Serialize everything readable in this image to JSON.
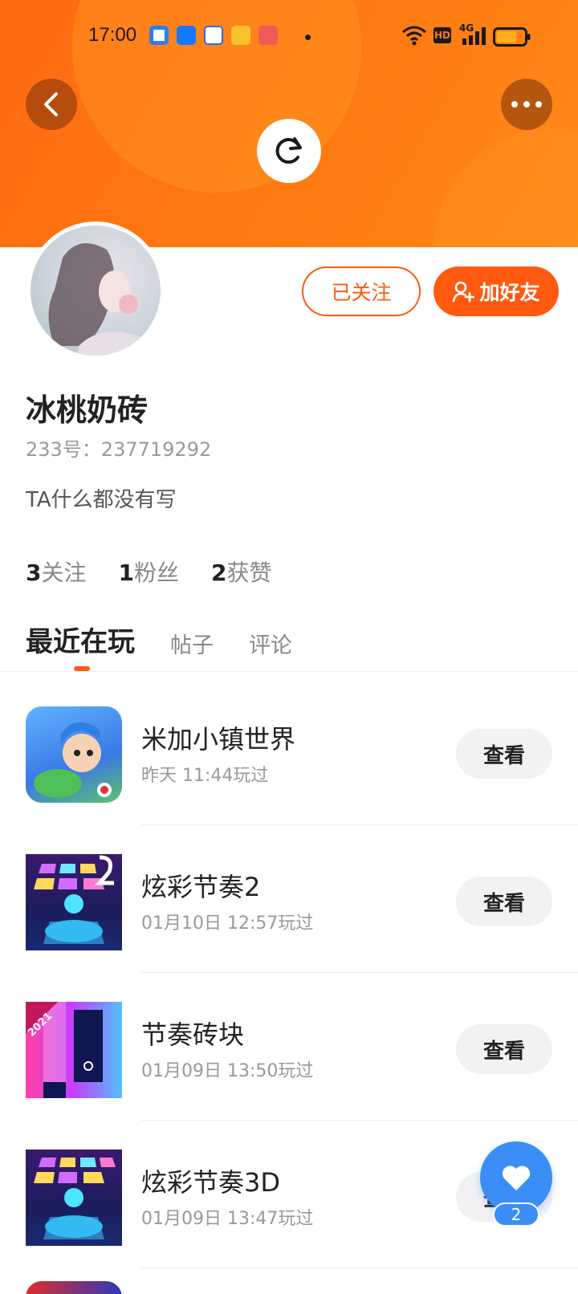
{
  "status_bar": {
    "time": "17:00",
    "network_label": "4G",
    "hd_label": "HD"
  },
  "header": {
    "back_icon": "chevron-left-icon",
    "more_icon": "more-dots-icon",
    "refresh_icon": "refresh-icon"
  },
  "profile": {
    "name": "冰桃奶砖",
    "uid": "233号：237719292",
    "bio": "TA什么都没有写",
    "followed_label": "已关注",
    "add_friend_label": "加好友",
    "stats": {
      "following_count": "3",
      "following_label": "关注",
      "fans_count": "1",
      "fans_label": "粉丝",
      "likes_count": "2",
      "likes_label": "获赞"
    }
  },
  "tabs": [
    {
      "label": "最近在玩"
    },
    {
      "label": "帖子"
    },
    {
      "label": "评论"
    }
  ],
  "games": [
    {
      "name": "米加小镇世界",
      "time": "昨天 11:44玩过",
      "action": "查看"
    },
    {
      "name": "炫彩节奏2",
      "time": "01月10日 12:57玩过",
      "action": "查看"
    },
    {
      "name": "节奏砖块",
      "time": "01月09日 13:50玩过",
      "action": "查看",
      "badge": "2021"
    },
    {
      "name": "炫彩节奏3D",
      "time": "01月09日 13:47玩过",
      "action": "查看"
    }
  ],
  "float_like": {
    "count": "2"
  },
  "colors": {
    "accent": "#ff5a10",
    "header": "#ff7a12",
    "like_blue": "#3a8ef6"
  }
}
